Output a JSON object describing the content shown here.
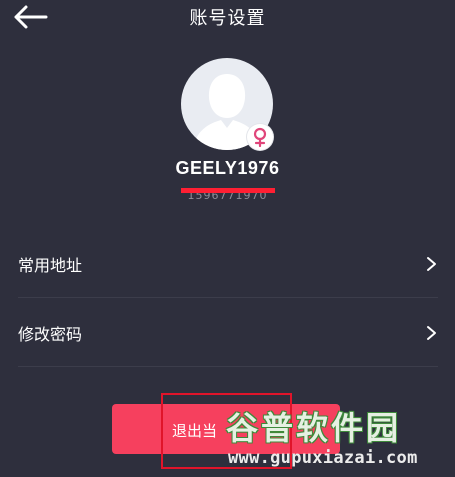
{
  "header": {
    "title": "账号设置",
    "back_icon": "arrow-left-icon"
  },
  "profile": {
    "avatar_icon": "default-avatar-icon",
    "gender_icon": "female-symbol-icon",
    "username": "GEELY1976",
    "phone": "1596771970"
  },
  "menu": {
    "items": [
      {
        "label": "常用地址",
        "icon": "chevron-right-icon"
      },
      {
        "label": "修改密码",
        "icon": "chevron-right-icon"
      }
    ]
  },
  "logout": {
    "label": "退出当"
  },
  "watermark": {
    "logo_text": "谷普软件园",
    "url": "www.gupuxiazai.com"
  },
  "colors": {
    "background": "#2e2f3d",
    "button": "#f6405e",
    "female": "#e0457a",
    "redaction": "#ff1f33"
  }
}
